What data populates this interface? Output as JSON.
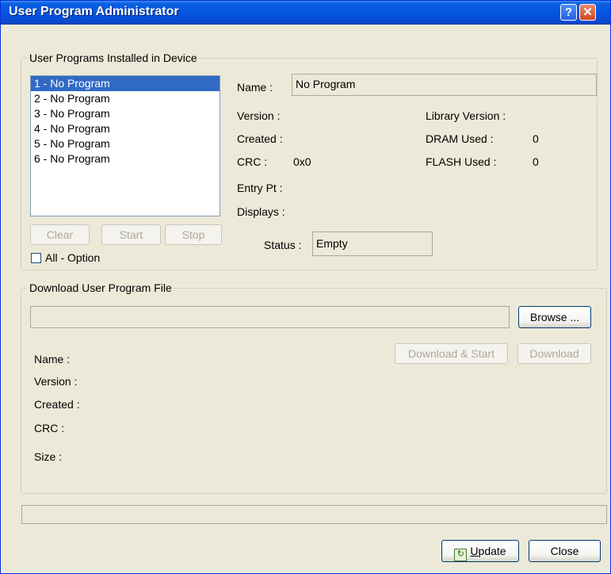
{
  "window": {
    "title": "User Program Administrator",
    "help_glyph": "?",
    "close_glyph": "✕"
  },
  "installed": {
    "legend": "User Programs Installed in Device",
    "programs": [
      {
        "label": "1 - No Program"
      },
      {
        "label": "2 - No Program"
      },
      {
        "label": "3 - No Program"
      },
      {
        "label": "4 - No Program"
      },
      {
        "label": "5 - No Program"
      },
      {
        "label": "6 - No Program"
      }
    ],
    "selected_index": 0,
    "buttons": {
      "clear": "Clear",
      "start": "Start",
      "stop": "Stop"
    },
    "all_option_label": "All - Option",
    "all_option_checked": false,
    "details": {
      "name_label": "Name :",
      "name_value": "No Program",
      "version_label": "Version :",
      "created_label": "Created :",
      "crc_label": "CRC :",
      "crc_value": "0x0",
      "entry_label": "Entry Pt :",
      "displays_label": "Displays :",
      "library_label": "Library Version :",
      "dram_label": "DRAM Used :",
      "dram_value": "0",
      "flash_label": "FLASH Used :",
      "flash_value": "0",
      "status_label": "Status :",
      "status_value": "Empty"
    }
  },
  "download": {
    "legend": "Download User Program File",
    "file_value": "",
    "browse_label": "Browse ...",
    "download_start_label": "Download & Start",
    "download_label": "Download",
    "name_label": "Name :",
    "version_label": "Version :",
    "created_label": "Created :",
    "crc_label": "CRC :",
    "size_label": "Size :"
  },
  "progress_value": 0,
  "footer": {
    "update_label": "Update",
    "update_mnemonic": "U",
    "update_rest": "pdate",
    "close_label": "Close"
  }
}
